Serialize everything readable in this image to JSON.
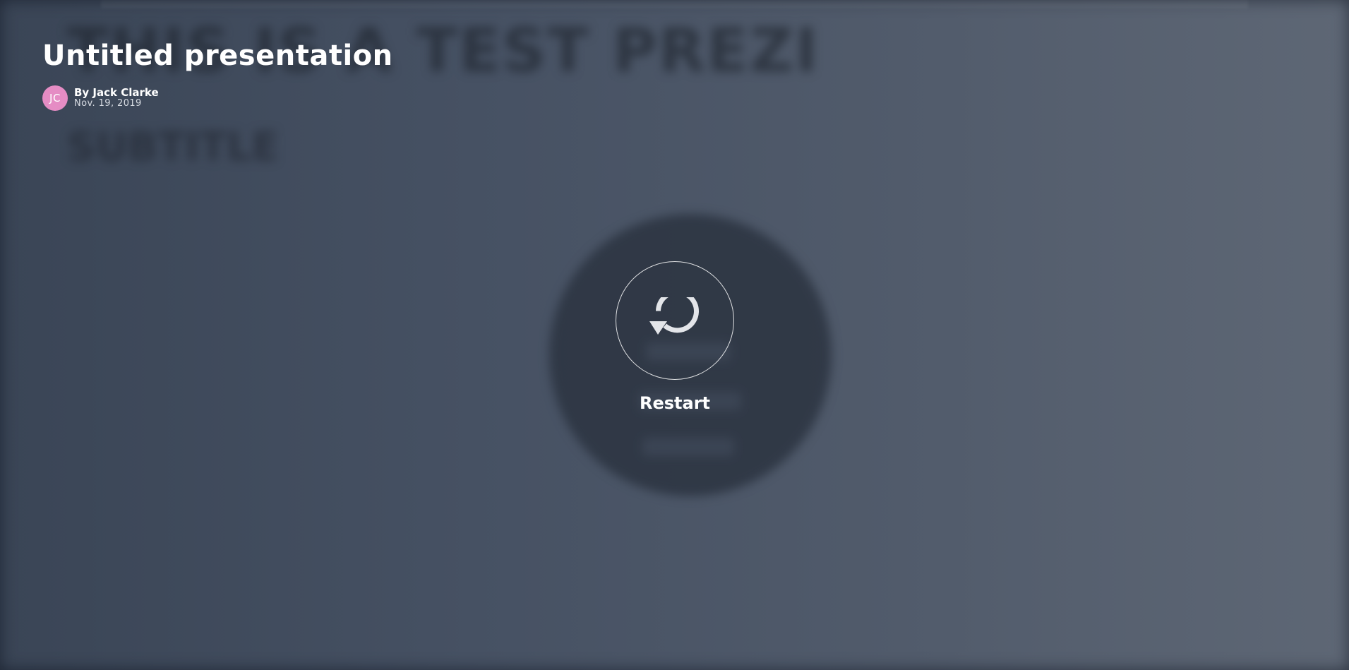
{
  "presentation": {
    "title": "Untitled presentation",
    "author_initials": "JC",
    "author_byline": "By Jack Clarke",
    "date": "Nov. 19, 2019"
  },
  "slide_background": {
    "heading": "THIS IS A TEST PREZI",
    "subtitle": "SUBTITLE"
  },
  "restart": {
    "label": "Restart",
    "icon": "restart-icon"
  },
  "colors": {
    "avatar": "#e58cc4",
    "background": "#465163",
    "text": "#ffffff"
  }
}
